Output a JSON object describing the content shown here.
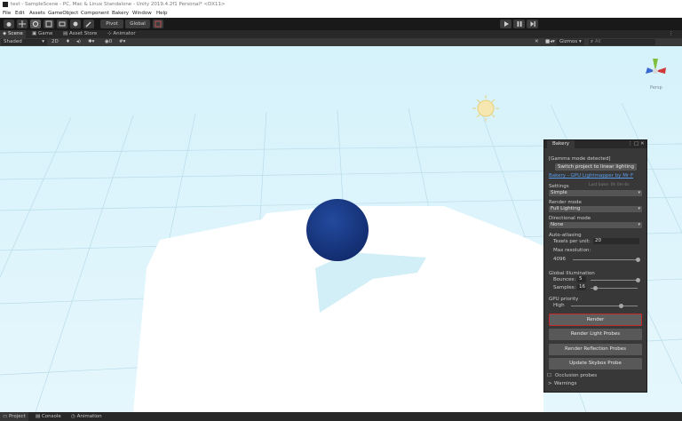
{
  "window": {
    "title": "test - SampleScene - PC, Mac & Linux Standalone - Unity 2019.4.2f1 Personal* <DX11>"
  },
  "menu": [
    "File",
    "Edit",
    "Assets",
    "GameObject",
    "Component",
    "Bakery",
    "Window",
    "Help"
  ],
  "toolbar": {
    "pivot_label": "Pivot",
    "global_label": "Global"
  },
  "tabs": {
    "scene": "Scene",
    "game": "Game",
    "asset_store": "Asset Store",
    "animator": "Animator"
  },
  "scene_toolbar": {
    "shading_mode": "Shaded",
    "mode_2d": "2D",
    "gizmos_label": "Gizmos",
    "search_placeholder": "All"
  },
  "viewport": {
    "persp_label": "Persp",
    "sphere_color": "#1a3a8c",
    "sky_color": "#dbf3fb",
    "floor_color": "#ffffff"
  },
  "bakery": {
    "tab_label": "Bakery",
    "gamma_notice": "[Gamma mode detected]",
    "switch_button": "Switch project to linear lighting",
    "link_text": "Bakery - GPU Lightmapper by Mr F",
    "last_bake": "Last bake: 0h 0m 6s",
    "settings_label": "Settings",
    "settings_value": "Simple",
    "render_mode_label": "Render mode",
    "render_mode_value": "Full Lighting",
    "directional_mode_label": "Directional mode",
    "directional_mode_value": "None",
    "auto_atlasing_label": "Auto-atlasing",
    "texels_label": "Texels per unit:",
    "texels_value": "20",
    "max_res_label": "Max resolution:",
    "max_res_value": "4096",
    "max_res_fraction": 1.0,
    "gi_label": "Global Illumination",
    "bounces_label": "Bounces:",
    "bounces_value": "5",
    "bounces_fraction": 1.0,
    "samples_label": "Samples:",
    "samples_value": "16",
    "samples_fraction": 0.1,
    "gpu_priority_label": "GPU priority",
    "gpu_priority_value": "High",
    "gpu_priority_fraction": 0.75,
    "render_button": "Render",
    "render_light_probes_button": "Render Light Probes",
    "render_reflection_probes_button": "Render Reflection Probes",
    "update_skybox_probe_button": "Update Skybox Probe",
    "occlusion_probes_label": "Occlusion probes",
    "warnings_label": "Warnings",
    "accent_color": "#c42a2a"
  },
  "bottom_tabs": {
    "project": "Project",
    "console": "Console",
    "animation": "Animation"
  }
}
